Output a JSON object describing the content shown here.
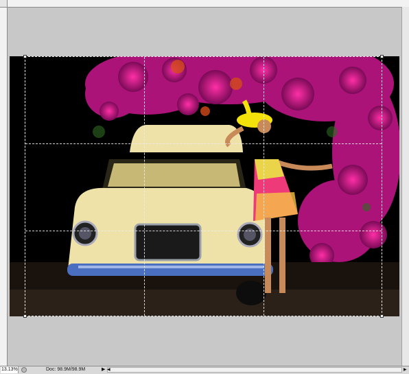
{
  "status": {
    "zoom": "13.13%",
    "doc_label": "Doc:",
    "doc_size": "98.9M/98.9M",
    "arrow": "▶"
  },
  "scroll": {
    "left_arrow": "◀",
    "right_arrow": "▶"
  },
  "colors": {
    "background": "#c8c8c8",
    "ruler": "#f2f2f2",
    "status_bar": "#d9d9d9",
    "flowers_magenta": "#c01a8a",
    "car_cream": "#efe2a8",
    "car_bumper": "#4a6ec0",
    "hat_yellow": "#f5e20a",
    "dress_pink": "#ef3a7a"
  },
  "icons": [
    "ruler",
    "navigator-icon",
    "scroll-arrow-icon"
  ]
}
